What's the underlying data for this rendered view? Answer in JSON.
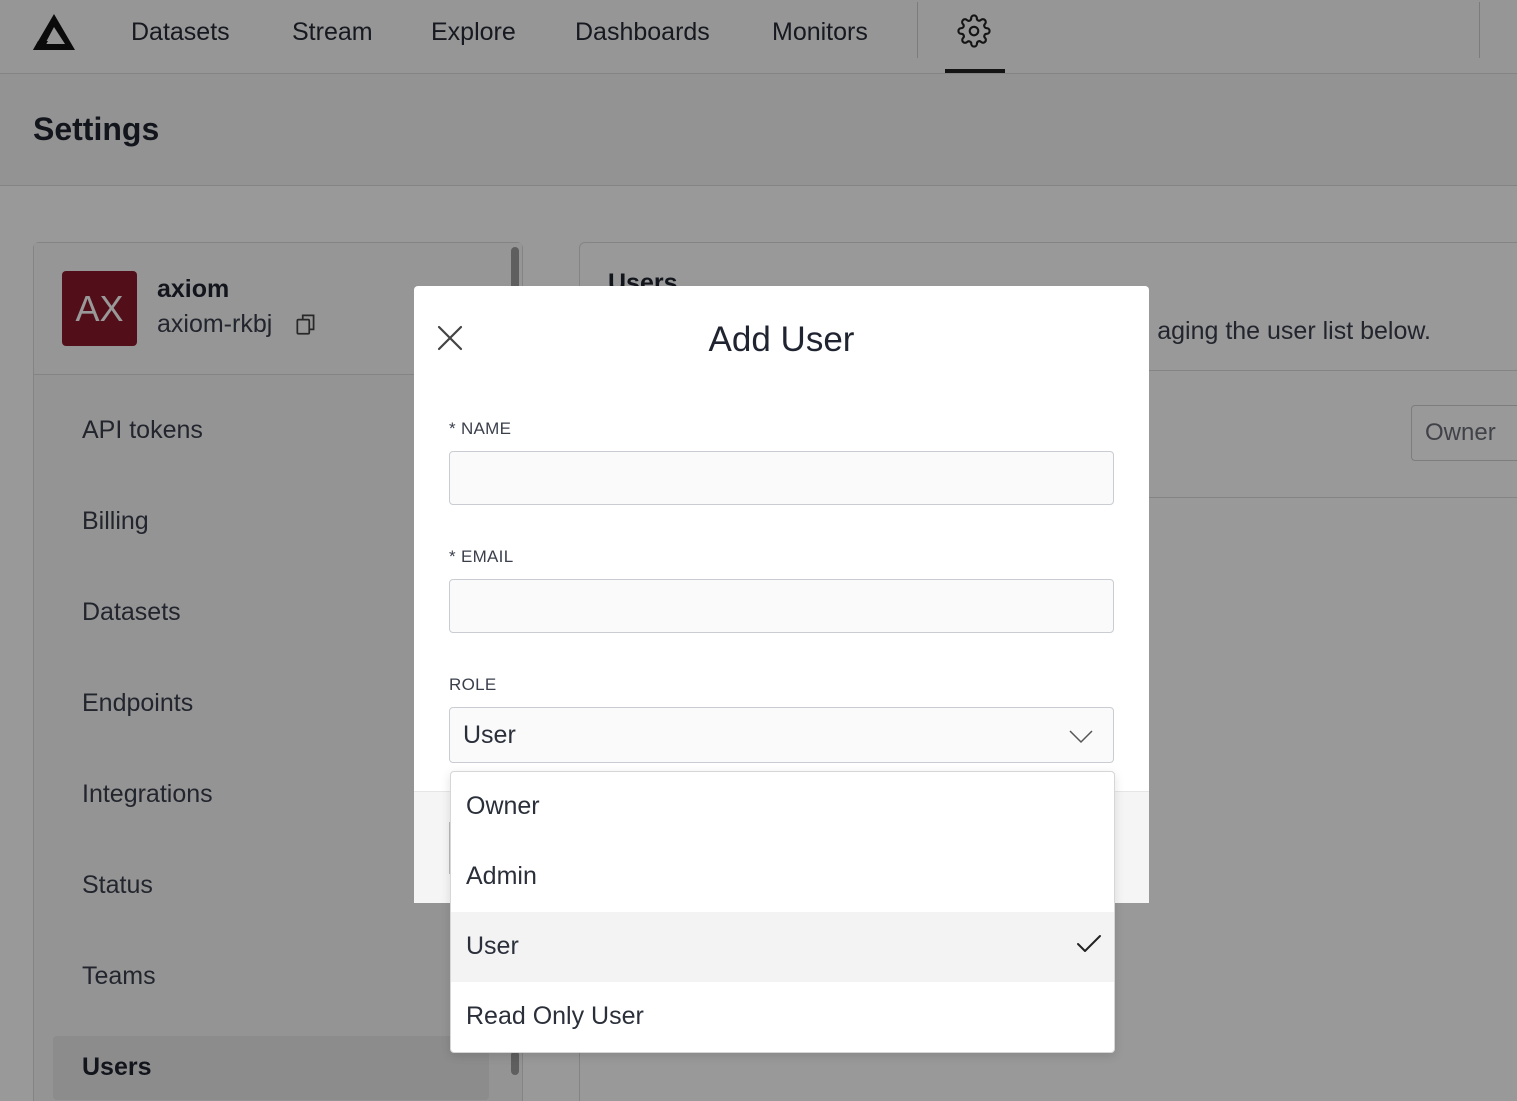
{
  "nav": {
    "items": [
      "Datasets",
      "Stream",
      "Explore",
      "Dashboards",
      "Monitors"
    ],
    "settings_icon": "gear-icon",
    "logo_icon": "axiom-logo-icon"
  },
  "settings_page": {
    "title": "Settings"
  },
  "sidebar": {
    "org": {
      "avatar_initials": "AX",
      "name": "axiom",
      "id": "axiom-rkbj",
      "avatar_color": "#8b1a2b"
    },
    "items": [
      {
        "label": "API tokens"
      },
      {
        "label": "Billing"
      },
      {
        "label": "Datasets"
      },
      {
        "label": "Endpoints"
      },
      {
        "label": "Integrations"
      },
      {
        "label": "Status"
      },
      {
        "label": "Teams"
      },
      {
        "label": "Users",
        "active": true
      }
    ]
  },
  "main": {
    "heading": "Users",
    "description_visible": "aging the user list below.",
    "row_role": "Owner"
  },
  "modal": {
    "title": "Add User",
    "name_label": "* NAME",
    "name_value": "",
    "email_label": "* EMAIL",
    "email_value": "",
    "role_label": "ROLE",
    "role_value": "User"
  },
  "dropdown": {
    "options": [
      {
        "label": "Owner",
        "selected": false
      },
      {
        "label": "Admin",
        "selected": false
      },
      {
        "label": "User",
        "selected": true
      },
      {
        "label": "Read Only User",
        "selected": false
      }
    ]
  }
}
